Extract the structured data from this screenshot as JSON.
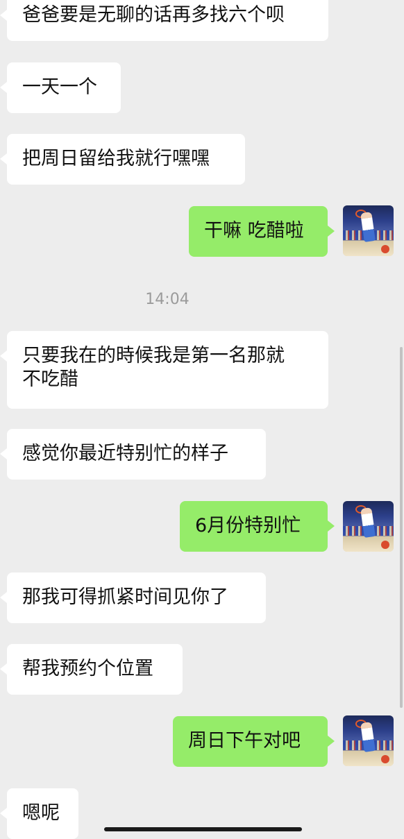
{
  "chat": {
    "messages": [
      {
        "side": "in",
        "text": "爸爸要是无聊的话再多找六个呗"
      },
      {
        "side": "in",
        "text": "一天一个"
      },
      {
        "side": "in",
        "text": "把周日留给我就行嘿嘿"
      },
      {
        "side": "out",
        "text": "干嘛 吃醋啦"
      },
      {
        "side": "in",
        "text": "只要我在的時候我是第一名那就\n不吃醋"
      },
      {
        "side": "in",
        "text": "感觉你最近特别忙的样子"
      },
      {
        "side": "out",
        "text": "6月份特别忙"
      },
      {
        "side": "in",
        "text": "那我可得抓紧时间见你了"
      },
      {
        "side": "in",
        "text": "帮我预约个位置"
      },
      {
        "side": "out",
        "text": "周日下午对吧"
      },
      {
        "side": "in",
        "text": "嗯呢"
      }
    ],
    "timestamp": "14:04"
  },
  "colors": {
    "background": "#ededed",
    "incoming_bubble": "#ffffff",
    "outgoing_bubble": "#95ec69",
    "timestamp_text": "#9b9b9b"
  },
  "icons": {
    "avatar": "user-avatar-basketball-photo"
  }
}
